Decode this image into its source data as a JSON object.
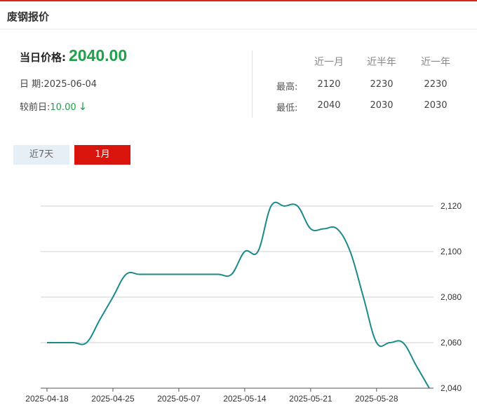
{
  "header": {
    "title": "废钢报价"
  },
  "summary": {
    "price_label": "当日价格:",
    "price_value": "2040.00",
    "date_label": "日 期:",
    "date_value": "2025-06-04",
    "change_label": "较前日:",
    "change_value": "10.00",
    "change_arrow": "↓"
  },
  "stats": {
    "columns": [
      "近一月",
      "近半年",
      "近一年"
    ],
    "rows": [
      {
        "label": "最高:",
        "values": [
          "2120",
          "2230",
          "2230"
        ]
      },
      {
        "label": "最低:",
        "values": [
          "2040",
          "2030",
          "2030"
        ]
      }
    ]
  },
  "tabs": [
    {
      "label": "近7天",
      "active": false
    },
    {
      "label": "1月",
      "active": true
    }
  ],
  "colors": {
    "up_down_green": "#1fa14a",
    "active_tab": "#d9140d",
    "line": "#1a8a8a",
    "grid": "#d0d0d0"
  },
  "chart_data": {
    "type": "line",
    "x": [
      "2025-04-18",
      "2025-04-21",
      "2025-04-22",
      "2025-04-23",
      "2025-04-24",
      "2025-04-25",
      "2025-04-28",
      "2025-04-29",
      "2025-04-30",
      "2025-05-06",
      "2025-05-07",
      "2025-05-08",
      "2025-05-09",
      "2025-05-12",
      "2025-05-13",
      "2025-05-14",
      "2025-05-15",
      "2025-05-16",
      "2025-05-19",
      "2025-05-20",
      "2025-05-21",
      "2025-05-22",
      "2025-05-23",
      "2025-05-26",
      "2025-05-27",
      "2025-05-28",
      "2025-05-29",
      "2025-05-30",
      "2025-06-03",
      "2025-06-04"
    ],
    "series": [
      {
        "values": [
          2060,
          2060,
          2060,
          2060,
          2070,
          2080,
          2090,
          2090,
          2090,
          2090,
          2090,
          2090,
          2090,
          2090,
          2090,
          2100,
          2100,
          2120,
          2120,
          2120,
          2110,
          2110,
          2110,
          2100,
          2080,
          2060,
          2060,
          2060,
          2050,
          2040
        ]
      }
    ],
    "x_tick_labels": [
      "2025-04-18",
      "2025-04-25",
      "2025-05-07",
      "2025-05-14",
      "2025-05-21",
      "2025-05-28"
    ],
    "y_ticks": [
      2040,
      2060,
      2080,
      2100,
      2120
    ],
    "y_tick_labels": [
      "2,040",
      "2,060",
      "2,080",
      "2,100",
      "2,120"
    ],
    "ylim": [
      2040,
      2120
    ],
    "y_axis_position": "right",
    "grid": true,
    "title": "",
    "xlabel": "",
    "ylabel": ""
  }
}
